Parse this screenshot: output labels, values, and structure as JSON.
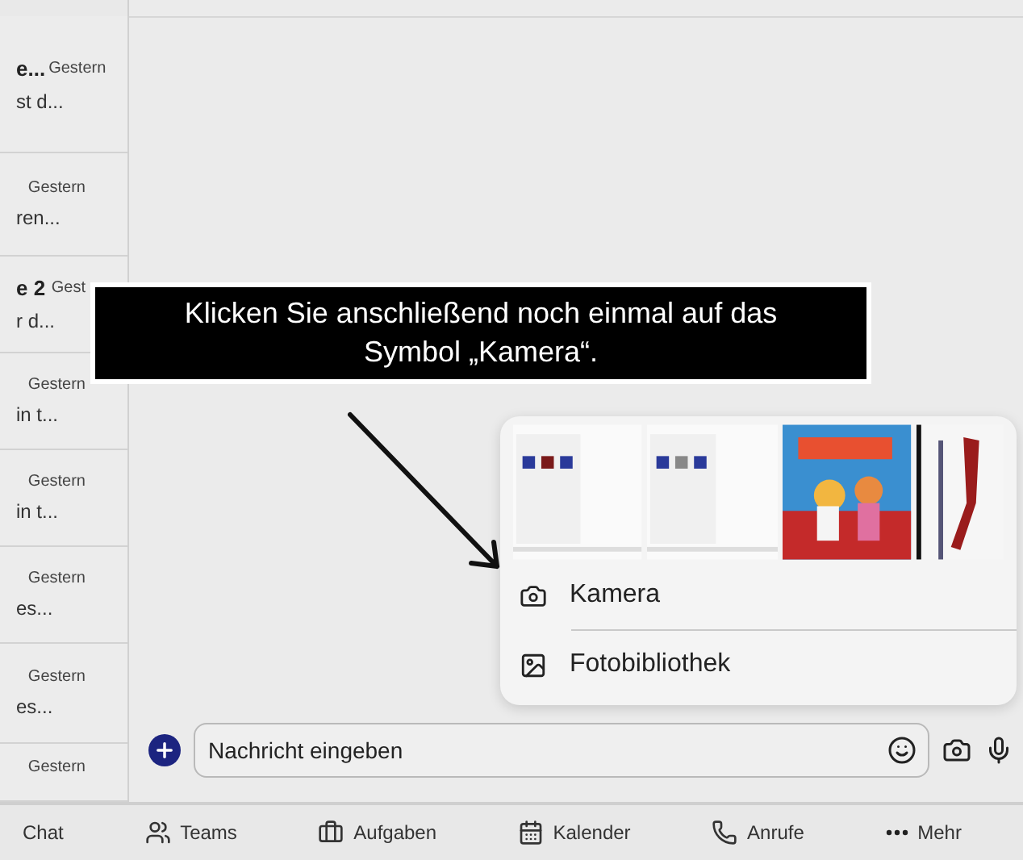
{
  "chat_list": [
    {
      "name": "e...",
      "preview": "st d...",
      "time": "Gestern"
    },
    {
      "preview": "ren...",
      "time": "Gestern"
    },
    {
      "name": "e 2",
      "preview": "r d...",
      "time": "Gest"
    },
    {
      "preview": "in t...",
      "time": "Gestern"
    },
    {
      "preview": "in t...",
      "time": "Gestern"
    },
    {
      "preview": "es...",
      "time": "Gestern"
    },
    {
      "preview": "es...",
      "time": "Gestern"
    },
    {
      "time": "Gestern"
    }
  ],
  "callout": {
    "text": "Klicken Sie anschließend noch einmal auf das Symbol „Kamera“."
  },
  "attach_menu": {
    "items": [
      {
        "kind": "camera",
        "label": "Kamera"
      },
      {
        "kind": "photos",
        "label": "Fotobibliothek"
      }
    ]
  },
  "composer": {
    "placeholder": "Nachricht eingeben"
  },
  "tab_bar": [
    {
      "kind": "chat",
      "label": "Chat"
    },
    {
      "kind": "teams",
      "label": "Teams"
    },
    {
      "kind": "tasks",
      "label": "Aufgaben"
    },
    {
      "kind": "calendar",
      "label": "Kalender"
    },
    {
      "kind": "calls",
      "label": "Anrufe"
    },
    {
      "kind": "more",
      "label": "Mehr"
    }
  ]
}
